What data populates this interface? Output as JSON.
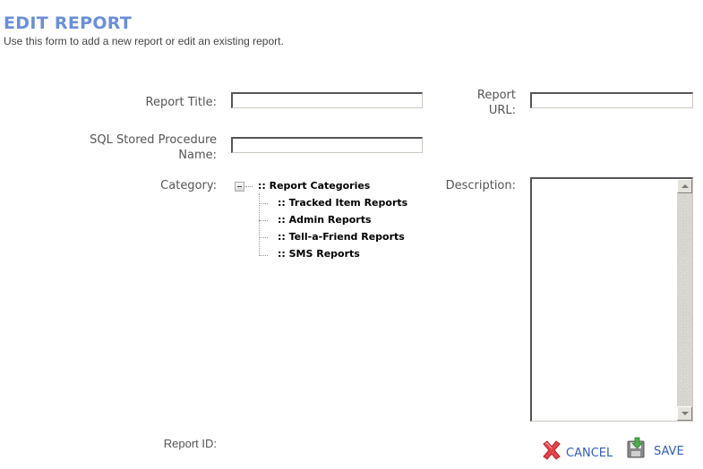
{
  "header": {
    "title": "EDIT REPORT",
    "subtitle": "Use this form to add a new report or edit an existing report."
  },
  "form": {
    "report_title": {
      "label": "Report Title:",
      "value": ""
    },
    "report_url": {
      "label_line1": "Report",
      "label_line2": "URL:",
      "value": ""
    },
    "sql_proc": {
      "label_line1": "SQL Stored Procedure",
      "label_line2": "Name:",
      "value": ""
    },
    "category": {
      "label": "Category:",
      "root": ":: Report Categories",
      "root_expanded": true,
      "children": [
        ":: Tracked Item Reports",
        ":: Admin Reports",
        ":: Tell-a-Friend Reports",
        ":: SMS Reports"
      ]
    },
    "description": {
      "label": "Description:",
      "value": ""
    },
    "report_id": {
      "label": "Report ID:",
      "value": ""
    }
  },
  "actions": {
    "cancel_label": "CANCEL",
    "save_label": "SAVE",
    "cancel_icon": "red-x-icon",
    "save_icon": "floppy-save-icon"
  }
}
